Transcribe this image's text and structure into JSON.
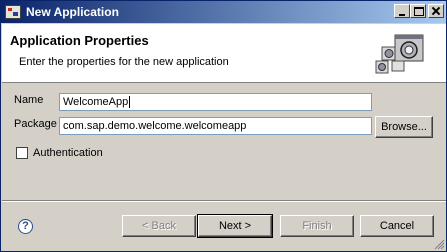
{
  "window": {
    "title": "New Application",
    "icons": {
      "app": "application-icon",
      "minimize": "minimize-icon",
      "maximize": "maximize-icon",
      "close": "close-icon"
    }
  },
  "header": {
    "title": "Application Properties",
    "description": "Enter the properties for the new application",
    "graphic": "new-application-wizard-icon"
  },
  "form": {
    "name_label": "Name",
    "name_value": "WelcomeApp",
    "package_label": "Package",
    "package_value": "com.sap.demo.welcome.welcomeapp",
    "browse_label": "Browse...",
    "authentication_label": "Authentication",
    "authentication_checked": false
  },
  "footer": {
    "help_icon": "help-icon",
    "help_glyph": "?",
    "back_label": "< Back",
    "next_label": "Next >",
    "finish_label": "Finish",
    "cancel_label": "Cancel"
  }
}
